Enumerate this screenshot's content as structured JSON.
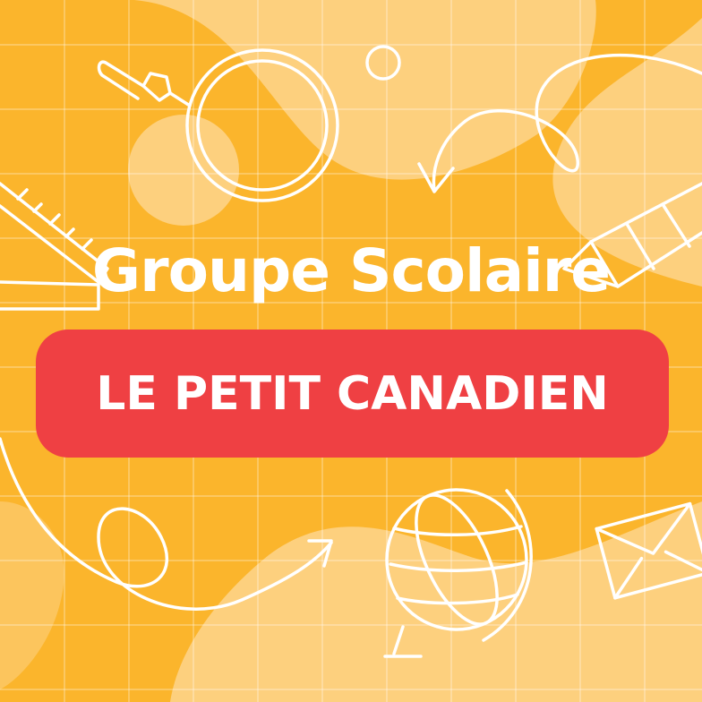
{
  "poster": {
    "title": "Groupe Scolaire",
    "banner": "LE PETIT CANADIEN"
  },
  "colors": {
    "background": "#fbb52c",
    "blob_light": "#fdd07e",
    "banner": "#ef4043",
    "text": "#ffffff"
  },
  "icons": [
    "grid-lines",
    "magnifier-icon",
    "ring-icon",
    "curly-arrow-icon",
    "ruler-icon",
    "pencil-icon",
    "loop-arrow-icon",
    "globe-icon",
    "envelope-icon",
    "bubble-icon"
  ]
}
